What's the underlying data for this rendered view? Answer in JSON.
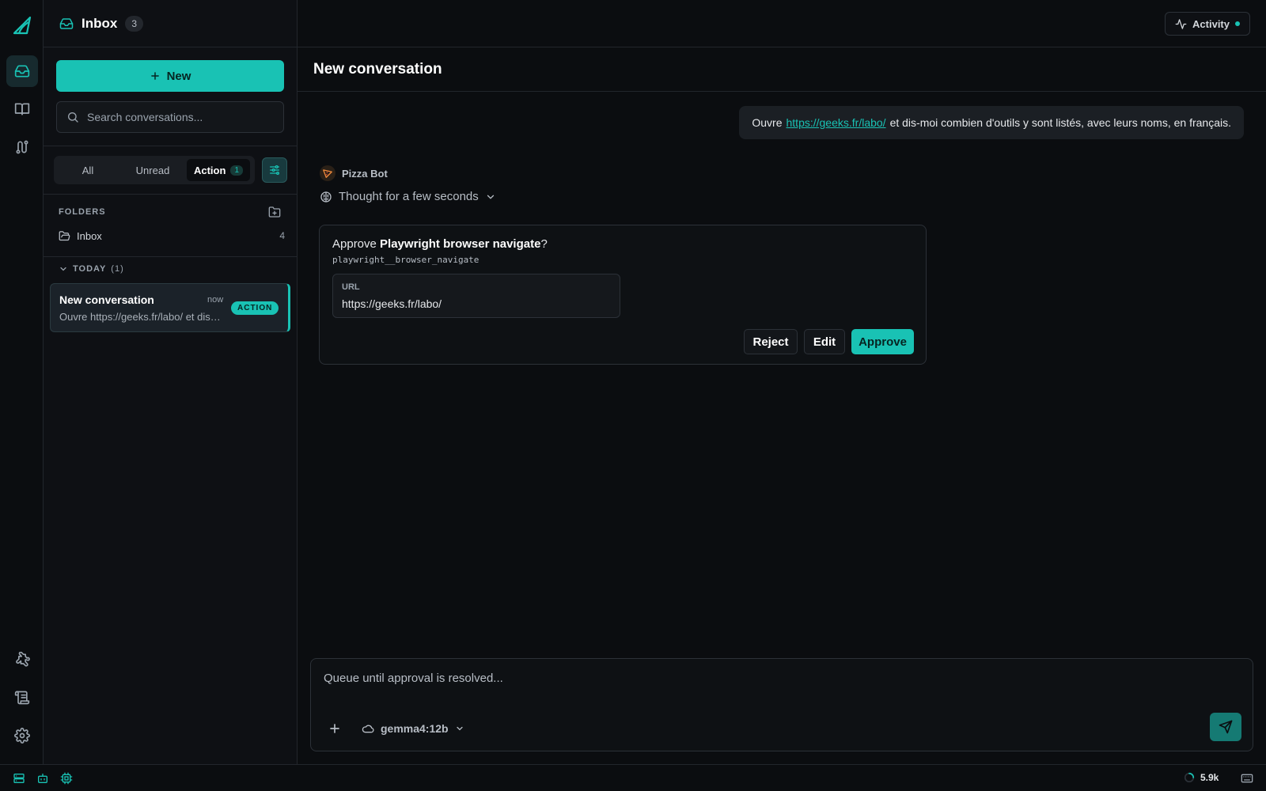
{
  "colors": {
    "accent": "#19c2b4",
    "background": "#0b0d10",
    "panel": "#0e1014"
  },
  "rail": {
    "icons": [
      "logo-icon",
      "inbox-icon",
      "book-icon",
      "route-icon",
      "puzzle-icon",
      "scroll-icon",
      "gear-icon"
    ]
  },
  "sidebar": {
    "title": "Inbox",
    "count": "3",
    "new_label": "New",
    "search_placeholder": "Search conversations...",
    "filters": [
      {
        "label": "All"
      },
      {
        "label": "Unread"
      },
      {
        "label": "Action",
        "count": "1",
        "active": true
      }
    ],
    "folders_label": "FOLDERS",
    "folders": [
      {
        "name": "Inbox",
        "count": "4"
      }
    ],
    "group": {
      "label": "TODAY",
      "count": "(1)"
    },
    "conversations": [
      {
        "title": "New conversation",
        "time": "now",
        "preview": "Ouvre https://geeks.fr/labo/ et dis-moi combien d'outils y sont listés, avec leurs noms, en français.",
        "badge": "ACTION"
      }
    ]
  },
  "header": {
    "activity_label": "Activity"
  },
  "main": {
    "title": "New conversation",
    "user_message": {
      "before": "Ouvre",
      "link": "https://geeks.fr/labo/",
      "after": "et dis-moi combien d'outils y sont listés, avec leurs noms, en français."
    },
    "bot_name": "Pizza Bot",
    "thought": "Thought for a few seconds",
    "approval": {
      "prefix": "Approve",
      "tool_name": "Playwright browser navigate",
      "suffix": "?",
      "tool_id": "playwright__browser_navigate",
      "field_label": "URL",
      "field_value": "https://geeks.fr/labo/",
      "reject_label": "Reject",
      "edit_label": "Edit",
      "approve_label": "Approve"
    },
    "composer": {
      "placeholder": "Queue until approval is resolved...",
      "model": "gemma4:12b"
    }
  },
  "statusbar": {
    "tokens": "5.9k"
  }
}
